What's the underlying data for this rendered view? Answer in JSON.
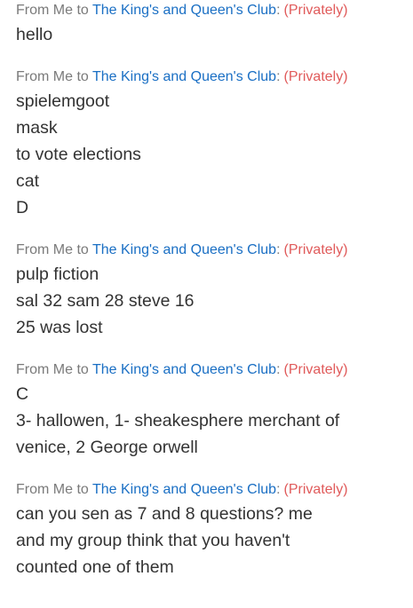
{
  "messages": [
    {
      "from": "From Me to",
      "club": "The King's and Queen's Club",
      "sep": ":",
      "visibility": "(Privately)",
      "lines": [
        "hello"
      ]
    },
    {
      "from": "From Me to",
      "club": "The King's and Queen's Club",
      "sep": ":",
      "visibility": "(Privately)",
      "lines": [
        "spielemgoot",
        "mask",
        "to vote elections",
        "cat",
        "D"
      ]
    },
    {
      "from": "From Me to",
      "club": "The King's and Queen's Club",
      "sep": ":",
      "visibility": "(Privately)",
      "lines": [
        "pulp fiction",
        "sal 32 sam 28 steve 16",
        "25 was lost"
      ]
    },
    {
      "from": "From Me to",
      "club": "The King's and Queen's Club",
      "sep": ":",
      "visibility": "(Privately)",
      "lines": [
        "C",
        "3- hallowen, 1- sheakesphere merchant of",
        "venice, 2 George orwell"
      ]
    },
    {
      "from": "From Me to",
      "club": "The King's and Queen's Club",
      "sep": ":",
      "visibility": "(Privately)",
      "lines": [
        "can you sen as 7 and 8 questions? me",
        "and my group think that you haven't",
        "counted one of them"
      ]
    }
  ]
}
